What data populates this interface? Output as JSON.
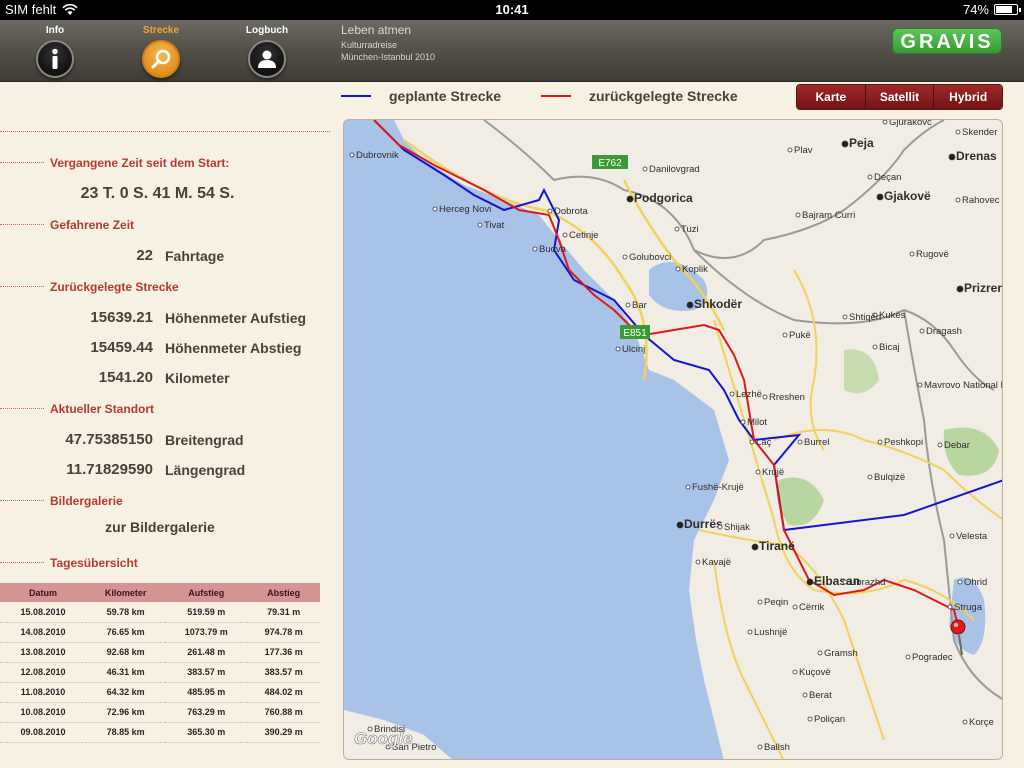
{
  "status": {
    "carrier": "SIM fehlt",
    "time": "10:41",
    "battery": "74%",
    "battery_level": 0.74
  },
  "nav": {
    "tabs": [
      {
        "label": "Info"
      },
      {
        "label": "Strecke"
      },
      {
        "label": "Logbuch"
      }
    ],
    "trip_title": "Leben atmen",
    "trip_line1": "Kulturradreise",
    "trip_line2": "München-Istanbul 2010",
    "brand": "GRAVIS"
  },
  "colors": {
    "accent": "#f3a530",
    "planned": "#1414d0",
    "traveled": "#e01818",
    "header_red": "#b43a32"
  },
  "stats": {
    "elapsed_head": "Vergangene Zeit seit dem Start:",
    "elapsed_value": "23 T. 0 S. 41 M. 54 S.",
    "ride_head": "Gefahrene Zeit",
    "ride_days": "22",
    "ride_days_unit": "Fahrtage",
    "distance_head": "Zurückgelegte Strecke",
    "ascent": "15639.21",
    "ascent_unit": "Höhenmeter Aufstieg",
    "descent": "15459.44",
    "descent_unit": "Höhenmeter Abstieg",
    "km": "1541.20",
    "km_unit": "Kilometer",
    "location_head": "Aktueller Standort",
    "lat": "47.75385150",
    "lat_unit": "Breitengrad",
    "lon": "11.71829590",
    "lon_unit": "Längengrad",
    "gallery_head": "Bildergalerie",
    "gallery_link": "zur Bildergalerie",
    "daily_head": "Tagesübersicht"
  },
  "table": {
    "headers": [
      "Datum",
      "Kilometer",
      "Aufstieg",
      "Abstieg"
    ],
    "rows": [
      [
        "15.08.2010",
        "59.78  km",
        "519.59  m",
        "79.31  m"
      ],
      [
        "14.08.2010",
        "76.65  km",
        "1073.79  m",
        "974.78  m"
      ],
      [
        "13.08.2010",
        "92.68  km",
        "261.48  m",
        "177.36  m"
      ],
      [
        "12.08.2010",
        "46.31  km",
        "383.57  m",
        "383.57  m"
      ],
      [
        "11.08.2010",
        "64.32  km",
        "485.95  m",
        "484.02  m"
      ],
      [
        "10.08.2010",
        "72.96  km",
        "763.29  m",
        "760.88  m"
      ],
      [
        "09.08.2010",
        "78.85  km",
        "365.30  m",
        "390.29  m"
      ]
    ]
  },
  "legend": {
    "planned": "geplante Strecke",
    "traveled": "zurückgelegte Strecke"
  },
  "map_modes": [
    "Karte",
    "Satellit",
    "Hybrid"
  ],
  "map": {
    "places": [
      "Dubrovnik",
      "Herceg Novi",
      "Tivat",
      "Budva",
      "Bar",
      "Ulcinj",
      "Dobrota",
      "Cetinje",
      "Podgorica",
      "Danilovgrad",
      "Golubovci",
      "Tuzi",
      "Koplik",
      "Shkodër",
      "Lezhë",
      "Milot",
      "Laç",
      "Krujë",
      "Fushë-Krujë",
      "Burrel",
      "Durrës",
      "Shijak",
      "Tiranë",
      "Kavajë",
      "Elbasan",
      "Librazhd",
      "Cërrik",
      "Peqin",
      "Lushnjë",
      "Gramsh",
      "Kuçovë",
      "Berat",
      "Poliçan",
      "Ballsh",
      "Pogradec",
      "Struga",
      "Ohrid",
      "Velesta",
      "Debar",
      "Peshkopi",
      "Bulqizë",
      "Rreshen",
      "Pukë",
      "Bicaj",
      "Kukës",
      "Prizren",
      "Gjakovë",
      "Peja",
      "Plav",
      "Deçan",
      "Rahovec",
      "Drenas",
      "Skender",
      "Gjurakovc",
      "Mavrovo National Park",
      "Bajram Curri",
      "Shtiqën",
      "Dragash",
      "Rugovë",
      "Brindisi",
      "San Pietro",
      "Korçe"
    ],
    "roads": [
      "E762",
      "E851"
    ],
    "credit": "Google"
  }
}
